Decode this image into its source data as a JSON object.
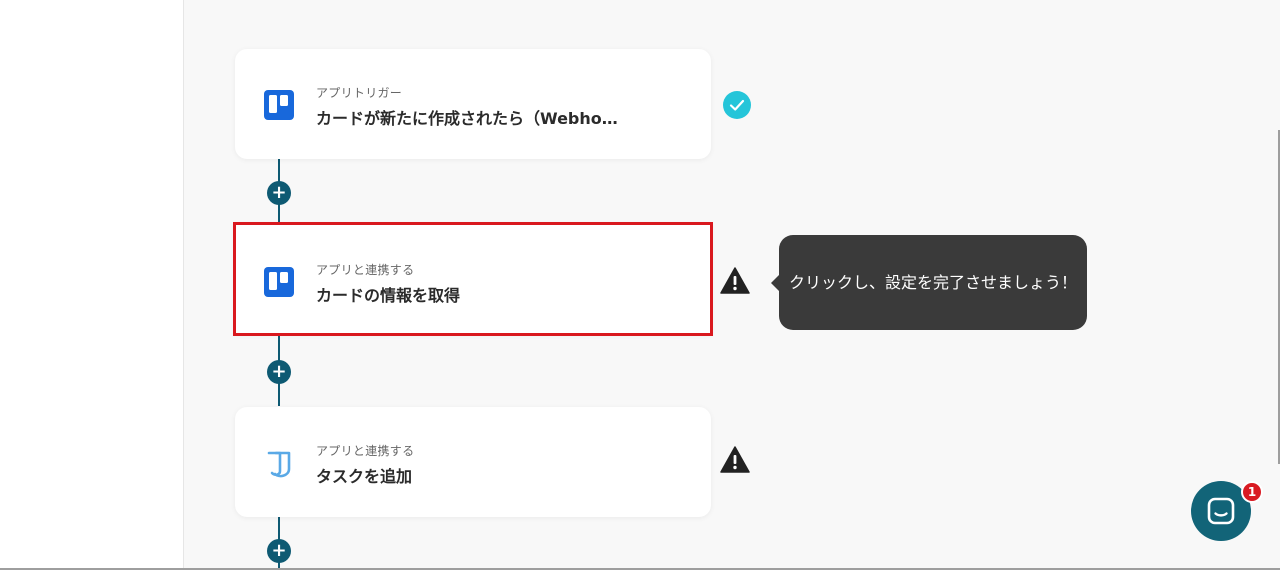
{
  "flow": {
    "steps": [
      {
        "subtitle": "アプリトリガー",
        "title": "カードが新たに作成されたら（Webho…",
        "app_icon": "trello-icon",
        "status": "complete"
      },
      {
        "subtitle": "アプリと連携する",
        "title": "カードの情報を取得",
        "app_icon": "trello-icon",
        "status": "warning"
      },
      {
        "subtitle": "アプリと連携する",
        "title": "タスクを追加",
        "app_icon": "jooto-icon",
        "status": "warning"
      }
    ],
    "add_label": "+"
  },
  "tooltip": {
    "text": "クリックし、設定を完了させましょう！"
  },
  "chat": {
    "badge_count": "1"
  },
  "colors": {
    "connector": "#0e5a73",
    "highlight_border": "#d9181e",
    "check": "#25c5d9",
    "tooltip_bg": "#3a3a3a",
    "chat_bg": "#126478",
    "badge_bg": "#d91a22"
  }
}
